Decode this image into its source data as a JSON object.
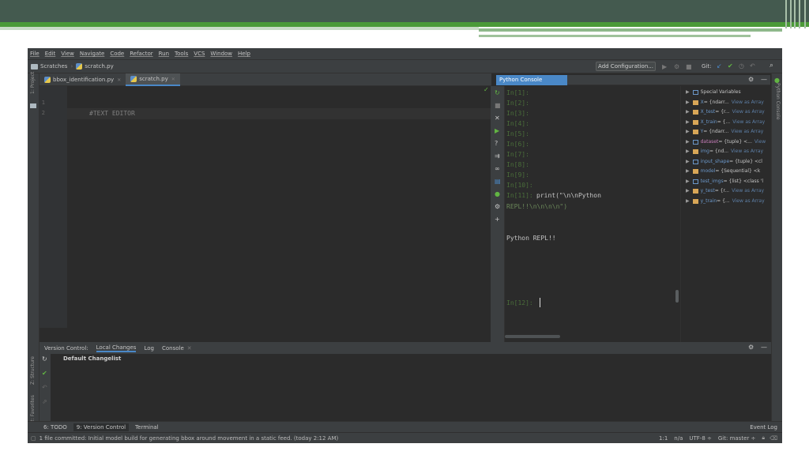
{
  "menu": [
    "File",
    "Edit",
    "View",
    "Navigate",
    "Code",
    "Refactor",
    "Run",
    "Tools",
    "VCS",
    "Window",
    "Help"
  ],
  "breadcrumb": {
    "root": "Scratches",
    "file": "scratch.py"
  },
  "toolbar": {
    "add_config": "Add Configuration...",
    "git_label": "Git:"
  },
  "left_strip": {
    "project": "1: Project",
    "structure": "Z: Structure",
    "favorites": "2: Favorites"
  },
  "editor_tabs": [
    {
      "label": "bbox_identification.py"
    },
    {
      "label": "scratch.py"
    }
  ],
  "editor": {
    "line_numbers": [
      "1",
      "2"
    ],
    "code": "#TEXT EDITOR"
  },
  "console": {
    "title": "Python Console",
    "prompts": [
      "In[1]:",
      "In[2]:",
      "In[3]:",
      "In[4]:",
      "In[5]:",
      "In[6]:",
      "In[7]:",
      "In[8]:",
      "In[9]:",
      "In[10]:",
      "In[11]:"
    ],
    "cmd_prompt": "In[11]:",
    "cmd_line1": " print(\"\\n\\nPython",
    "cmd_line2": " REPL!!\\n\\n\\n\\n\")",
    "output": "Python REPL!!",
    "current_prompt": "In[12]:"
  },
  "variables": [
    {
      "name": "Special Variables",
      "type": "",
      "view": ""
    },
    {
      "name": "X",
      "type": " = {ndarr...",
      "view": "View as Array"
    },
    {
      "name": "X_test",
      "type": " = {r...",
      "view": "View as Array"
    },
    {
      "name": "X_train",
      "type": " = {...",
      "view": "View as Array"
    },
    {
      "name": "Y",
      "type": " = {ndarr...",
      "view": "View as Array"
    },
    {
      "name": "dataset",
      "type": " = {tuple} <...",
      "view": "View"
    },
    {
      "name": "img",
      "type": " = {nd...",
      "view": "View as Array"
    },
    {
      "name": "input_shape",
      "type": " = {tuple} <cl",
      "view": ""
    },
    {
      "name": "model",
      "type": " = {Sequential} <k",
      "view": ""
    },
    {
      "name": "test_imgs",
      "type": " = {list} <class 'l",
      "view": ""
    },
    {
      "name": "y_test",
      "type": " = {r...",
      "view": "View as Array"
    },
    {
      "name": "y_train",
      "type": " = {...",
      "view": "View as Array"
    }
  ],
  "bottom_tabs": [
    "Version Control:",
    "Local Changes",
    "Log",
    "Console"
  ],
  "changelist": "Default Changelist",
  "tool_windows": [
    "6: TODO",
    "9: Version Control",
    "Terminal"
  ],
  "event_log": "Event Log",
  "status": {
    "message": "1 file committed: Initial model build for generating bbox around movement in a static feed. (today 2:12 AM)",
    "position": "1:1",
    "na": "n/a",
    "encoding": "UTF-8 ÷",
    "git": "Git: master ÷"
  },
  "colors": {
    "accent": "#4a88c7",
    "header_dark": "#445a4f",
    "header_green": "#4b9a38",
    "prompt_green": "#4a6e3a",
    "string_green": "#6a8759"
  }
}
